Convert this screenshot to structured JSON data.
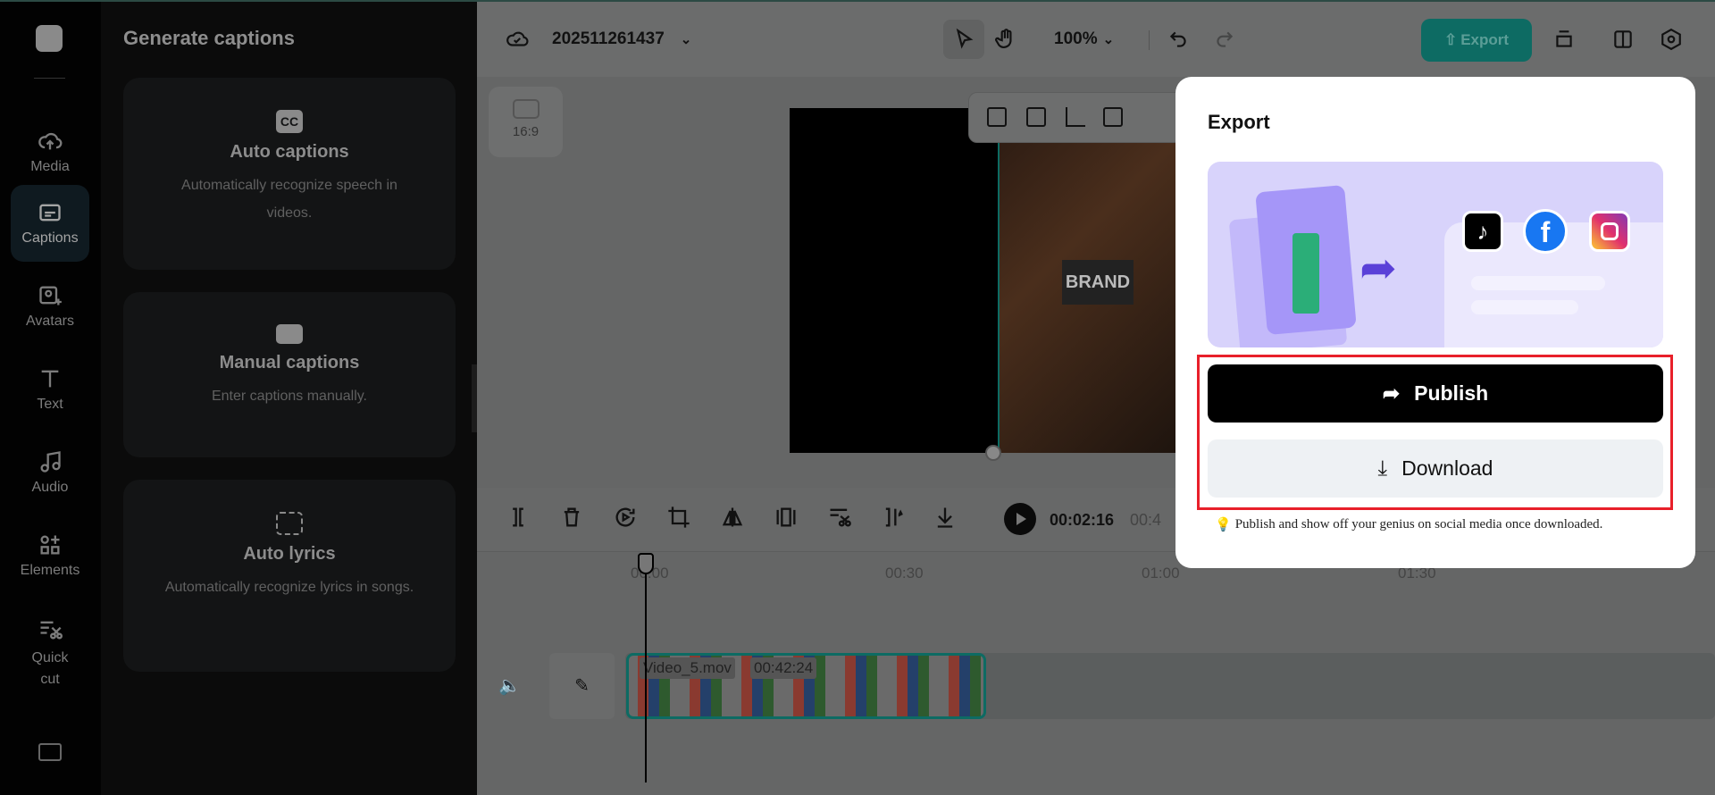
{
  "sidebar": {
    "items": [
      {
        "label": "Media",
        "icon": "cloud-upload-icon"
      },
      {
        "label": "Captions",
        "icon": "captions-icon",
        "active": true
      },
      {
        "label": "Avatars",
        "icon": "avatar-icon"
      },
      {
        "label": "Text",
        "icon": "text-icon"
      },
      {
        "label": "Audio",
        "icon": "music-icon"
      },
      {
        "label": "Elements",
        "icon": "elements-icon"
      },
      {
        "label": "Quick cut",
        "icon": "quick-cut-icon"
      }
    ]
  },
  "panel": {
    "title": "Generate captions",
    "cards": [
      {
        "title": "Auto captions",
        "desc": "Automatically recognize speech in videos."
      },
      {
        "title": "Manual captions",
        "desc": "Enter captions manually."
      },
      {
        "title": "Auto lyrics",
        "desc": "Automatically recognize lyrics in songs."
      }
    ]
  },
  "topbar": {
    "project_name": "202511261437",
    "zoom": "100%",
    "export_label": "Export"
  },
  "canvas": {
    "aspect": "16:9",
    "video_text": "BRAND"
  },
  "timeline": {
    "current_time": "00:02:16",
    "total_time_partial": "00:4",
    "ticks": [
      "00:00",
      "00:30",
      "01:00",
      "01:30"
    ],
    "clip_name": "Video_5.mov",
    "clip_duration": "00:42:24"
  },
  "export_modal": {
    "title": "Export",
    "publish_label": "Publish",
    "download_label": "Download",
    "hint": "Publish and show off your genius on social media once downloaded.",
    "platforms": [
      "tiktok",
      "facebook",
      "instagram"
    ]
  },
  "colors": {
    "accent": "#0d6b63",
    "highlight": "#e8202a"
  }
}
